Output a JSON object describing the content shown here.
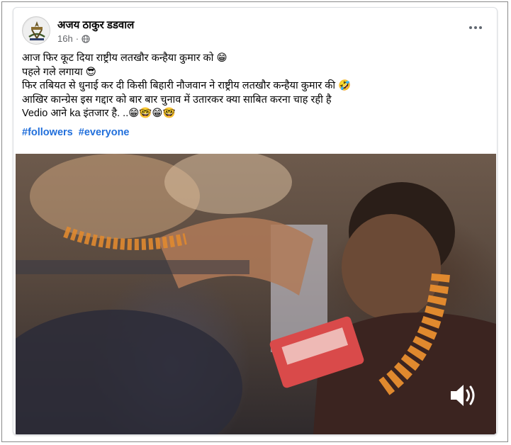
{
  "post": {
    "author": "अजय ठाकुर डडवाल",
    "time": "16h",
    "privacy_icon": "globe-icon",
    "more_icon": "more-options-icon",
    "lines": [
      "आज फिर कूट दिया राष्ट्रीय लतखौर कन्हैया कुमार को 😁",
      "पहले गले लगाया 😎",
      "फिर तबियत से धुनाई कर दी किसी बिहारी नौजवान ने राष्ट्रीय लतखौर कन्हैया कुमार की 🤣",
      "आखिर कान्ग्रेस इस गद्दार को बार बार चुनाव में उतारकर क्या साबित करना चाह रही है",
      "Vedio आने ka इंतजार है. ..😁🤓😁🤓"
    ],
    "hashtags": [
      "#followers",
      "#everyone"
    ]
  },
  "video": {
    "sound_icon": "speaker-volume-icon"
  },
  "colors": {
    "hashtag": "#216fdb",
    "meta_text": "#65676b"
  }
}
